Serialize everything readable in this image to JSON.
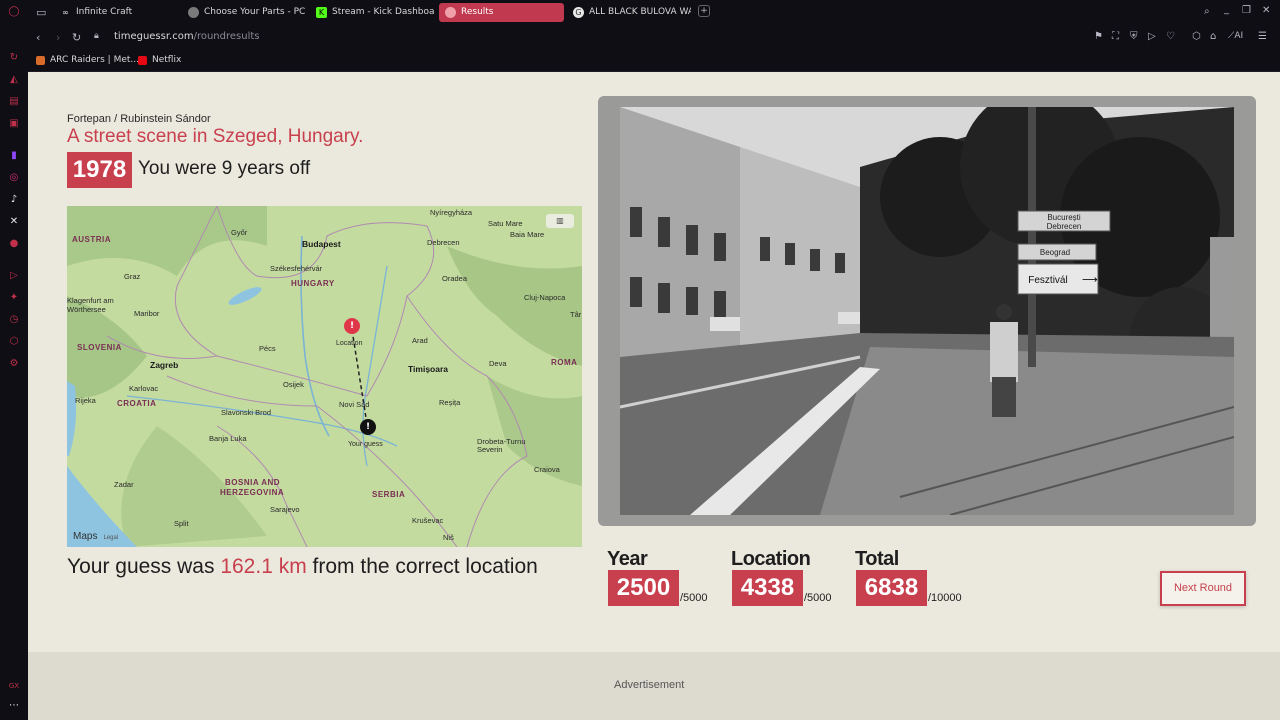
{
  "browser": {
    "tabs": [
      {
        "label": "Infinite Craft",
        "color": "#e8e8e8"
      },
      {
        "label": "Choose Your Parts - PCPa",
        "color": "#9c9c9c"
      },
      {
        "label": "Stream - Kick Dashboard",
        "color": "#53fc18"
      },
      {
        "label": "Results",
        "color": "#e85a6a"
      },
      {
        "label": "ALL BLACK BULOVA WATC",
        "color": "#e8e8e8"
      }
    ],
    "url_host": "timeguessr.com",
    "url_path": "/roundresults",
    "bookmarks": [
      {
        "label": "ARC Raiders | Met...",
        "color": "#d86a2a"
      },
      {
        "label": "Netflix",
        "color": "#e50914"
      }
    ],
    "toolbar_ai": "AI",
    "sidebar_bottom": "GX"
  },
  "result": {
    "credit": "Fortepan / Rubinstein Sándor",
    "title": "A street scene in Szeged, Hungary.",
    "year": "1978",
    "years_off_text": "You were 9 years off",
    "distance_prefix": "Your guess was ",
    "distance_value": "162.1 km",
    "distance_suffix": " from the correct location"
  },
  "map": {
    "labels": {
      "austria": "AUSTRIA",
      "hungary": "HUNGARY",
      "slovenia": "SLOVENIA",
      "croatia": "CROATIA",
      "bosnia1": "BOSNIA AND",
      "bosnia2": "HERZEGOVINA",
      "serbia": "SERBIA",
      "roma": "ROMA",
      "budapest": "Budapest",
      "zagreb": "Zagreb",
      "timisoara": "Timișoara",
      "gyor": "Győr",
      "graz": "Graz",
      "debrecen": "Debrecen",
      "nyiregyhaza": "Nyíregyháza",
      "satumare": "Satu Mare",
      "baiamare": "Baia Mare",
      "szekesfehervar": "Székesfehérvár",
      "oradea": "Oradea",
      "cluj": "Cluj-Napoca",
      "klagenfurt1": "Klagenfurt am",
      "klagenfurt2": "Wörthersee",
      "maribor": "Maribor",
      "pecs": "Pécs",
      "arad": "Arad",
      "deva": "Deva",
      "karlovac": "Karlovac",
      "osijek": "Osijek",
      "novisad": "Novi Sad",
      "resita": "Reșița",
      "rijeka": "Rijeka",
      "slavonski": "Slavonski Brod",
      "banjaluka": "Banja Luka",
      "drobeta1": "Drobeta-Turnu",
      "drobeta2": "Severin",
      "craiova": "Craiova",
      "zadar": "Zadar",
      "sarajevo": "Sarajevo",
      "krusevac": "Kruševac",
      "split": "Split",
      "nis": "Niš",
      "tar": "Târ",
      "location_pin": "Location",
      "guess_pin": "Your guess"
    },
    "logo": "Maps",
    "legal": "Legal"
  },
  "photo_signs": {
    "sign1a": "București",
    "sign1b": "Debrecen",
    "sign2": "Beograd",
    "sign3": "Fesztivál"
  },
  "scores": {
    "year_label": "Year",
    "year_value": "2500",
    "year_max": "/5000",
    "location_label": "Location",
    "location_value": "4338",
    "location_max": "/5000",
    "total_label": "Total",
    "total_value": "6838",
    "total_max": "/10000"
  },
  "next_round_label": "Next Round",
  "ad_label": "Advertisement"
}
